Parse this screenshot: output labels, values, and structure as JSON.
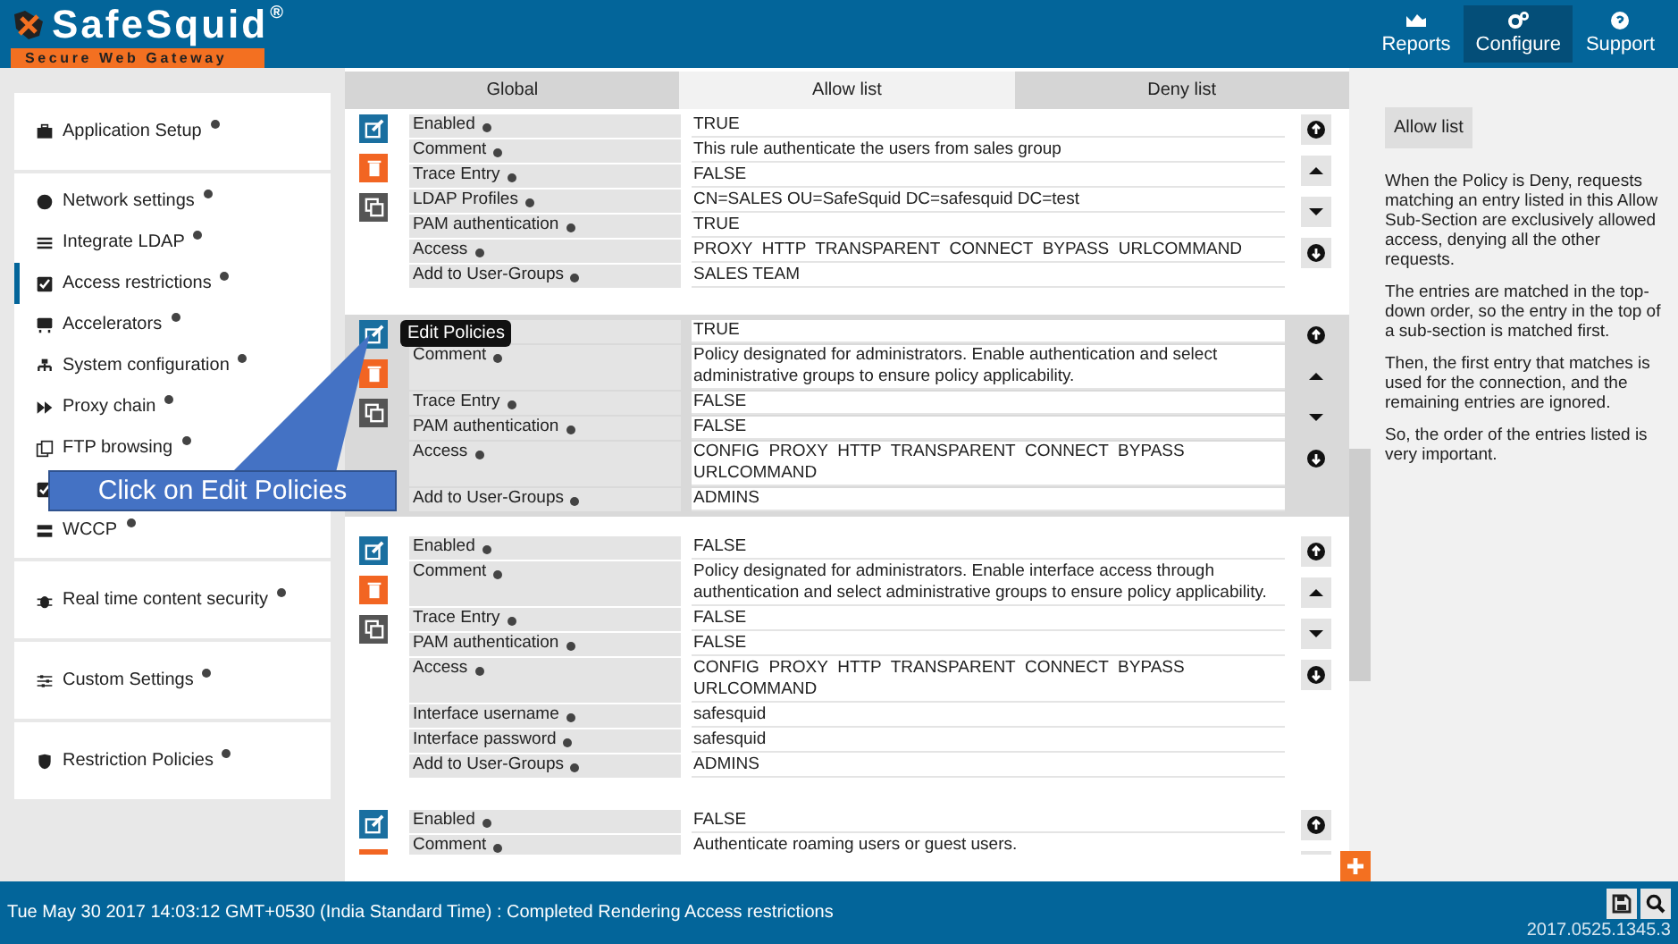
{
  "header": {
    "logo": "SafeSquid",
    "logo_mark": "®",
    "tagline": "Secure Web Gateway",
    "nav": [
      {
        "label": "Reports",
        "selected": false
      },
      {
        "label": "Configure",
        "selected": true
      },
      {
        "label": "Support",
        "selected": false
      }
    ]
  },
  "sidebar": {
    "groups": [
      {
        "items": [
          {
            "label": "Application Setup",
            "selected": false
          }
        ]
      },
      {
        "items": [
          {
            "label": "Network settings",
            "selected": false
          },
          {
            "label": "Integrate LDAP",
            "selected": false
          },
          {
            "label": "Access restrictions",
            "selected": true
          },
          {
            "label": "Accelerators",
            "selected": false
          },
          {
            "label": "System configuration",
            "selected": false
          },
          {
            "label": "Proxy chain",
            "selected": false
          },
          {
            "label": "FTP browsing",
            "selected": false
          },
          {
            "selected": false
          },
          {
            "label": "WCCP",
            "selected": false
          }
        ]
      },
      {
        "items": [
          {
            "label": "Real time content security",
            "selected": false
          }
        ]
      },
      {
        "items": [
          {
            "label": "Custom Settings",
            "selected": false
          }
        ]
      },
      {
        "items": [
          {
            "label": "Restriction Policies",
            "selected": false
          }
        ]
      }
    ]
  },
  "tabs": [
    {
      "label": "Global",
      "selected": false
    },
    {
      "label": "Allow list",
      "selected": true
    },
    {
      "label": "Deny list",
      "selected": false
    }
  ],
  "entries": [
    {
      "highlighted": false,
      "fields": [
        {
          "label": "Enabled",
          "value": "TRUE"
        },
        {
          "label": "Comment",
          "value": "This rule authenticate the users from sales group"
        },
        {
          "label": "Trace Entry",
          "value": "FALSE"
        },
        {
          "label": "LDAP Profiles",
          "value": "CN=SALES OU=SafeSquid DC=safesquid DC=test"
        },
        {
          "label": "PAM authentication",
          "value": "TRUE"
        },
        {
          "label": "Access",
          "value": "PROXY  HTTP  TRANSPARENT  CONNECT  BYPASS  URLCOMMAND"
        },
        {
          "label": "Add to User-Groups",
          "value": "SALES TEAM"
        }
      ]
    },
    {
      "highlighted": true,
      "tooltip": "Edit Policies",
      "fields": [
        {
          "value": "TRUE"
        },
        {
          "label": "Comment",
          "value": "Policy designated for administrators. Enable authentication and select administrative groups to ensure policy applicability."
        },
        {
          "label": "Trace Entry",
          "value": "FALSE"
        },
        {
          "label": "PAM authentication",
          "value": "FALSE"
        },
        {
          "label": "Access",
          "value": "CONFIG  PROXY  HTTP  TRANSPARENT  CONNECT  BYPASS  URLCOMMAND"
        },
        {
          "label": "Add to User-Groups",
          "value": "ADMINS"
        }
      ]
    },
    {
      "highlighted": false,
      "fields": [
        {
          "label": "Enabled",
          "value": "FALSE"
        },
        {
          "label": "Comment",
          "value": "Policy designated for administrators. Enable interface access through authentication and select administrative groups to ensure policy applicability."
        },
        {
          "label": "Trace Entry",
          "value": "FALSE"
        },
        {
          "label": "PAM authentication",
          "value": "FALSE"
        },
        {
          "label": "Access",
          "value": "CONFIG  PROXY  HTTP  TRANSPARENT  CONNECT  BYPASS  URLCOMMAND"
        },
        {
          "label": "Interface username",
          "value": "safesquid"
        },
        {
          "label": "Interface password",
          "value": "safesquid"
        },
        {
          "label": "Add to User-Groups",
          "value": "ADMINS"
        }
      ]
    },
    {
      "highlighted": false,
      "fields": [
        {
          "label": "Enabled",
          "value": "FALSE"
        },
        {
          "label": "Comment",
          "value": "Authenticate roaming users or guest users."
        }
      ]
    }
  ],
  "callout": "Click on Edit Policies",
  "help": {
    "title": "Allow list",
    "paragraphs": [
      "When the Policy is Deny, requests matching an entry listed in this Allow Sub-Section are exclusively allowed access, denying all the other requests.",
      "The entries are matched in the top-down order, so the entry in the top of a sub-section is matched first.",
      "Then, the first entry that matches is used for the connection, and the remaining entries are ignored.",
      "So, the order of the entries listed is very important."
    ]
  },
  "status_bar": {
    "message": "Tue May 30 2017 14:03:12 GMT+0530 (India Standard Time) : Completed Rendering Access restrictions",
    "version": "2017.0525.1345.3"
  }
}
